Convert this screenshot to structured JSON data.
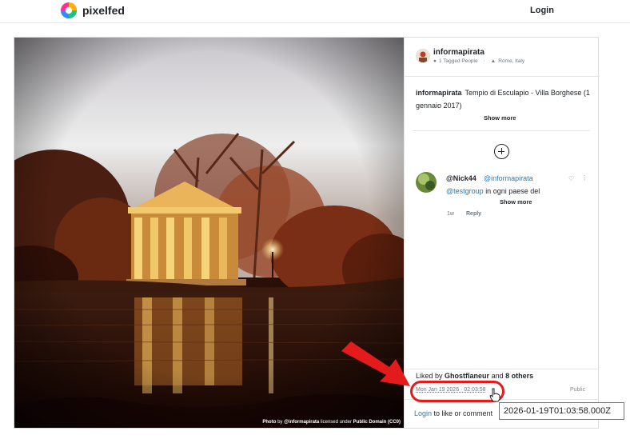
{
  "navbar": {
    "brand_name": "pixelfed",
    "login_label": "Login"
  },
  "post": {
    "photo_credit": {
      "prefix": "Photo",
      "by_label": "by",
      "author_handle": "@informapirata",
      "license_text": "licensed under",
      "license_name": "Public Domain (CC0)"
    },
    "header": {
      "author": "informapirata",
      "tagged_people": "1 Tagged People",
      "location": "Rome, Italy"
    },
    "caption": {
      "author": "informapirata",
      "text": "Tempio di Esculapio - Villa Borghese (1 gennaio 2017)",
      "show_more_label": "Show more"
    },
    "comment": {
      "username": "@Nick44",
      "mention": "@informapirata",
      "hashtag": "@testgroup",
      "text": "in ogni paese del",
      "show_more_label": "Show more",
      "time_ago": "1w",
      "reply_label": "Reply"
    },
    "likes": {
      "prefix": "Liked by",
      "user": "Ghostflaneur",
      "joiner": "and",
      "others": "8 others"
    },
    "timestamp": "Mon Jan 19 2026 · 02:03:58",
    "visibility": "Public",
    "login_prompt": {
      "link_label": "Login",
      "rest_text": "to like or comment"
    }
  },
  "tooltip": {
    "text": "2026-01-19T01:03:58.000Z"
  },
  "colors": {
    "annotation_red": "#e41b1b",
    "link_blue": "#2a7ab8"
  }
}
